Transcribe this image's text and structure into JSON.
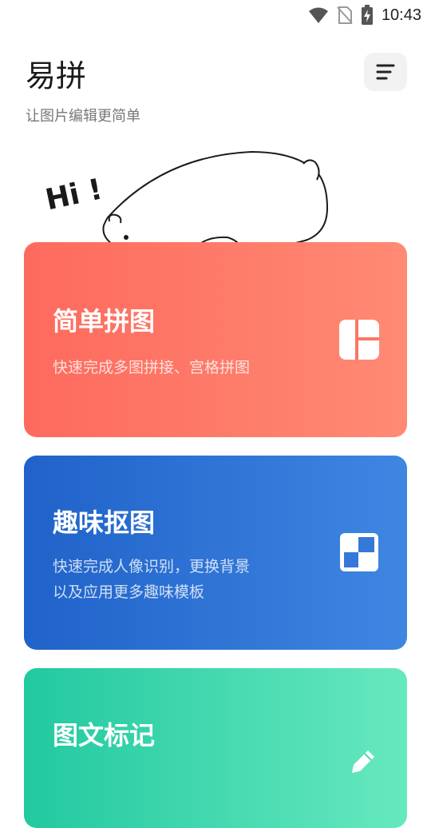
{
  "status": {
    "time": "10:43"
  },
  "header": {
    "title": "易拼",
    "subtitle": "让图片编辑更简单",
    "menu_icon": "menu-lines-icon"
  },
  "illustration": {
    "greeting": "Hi !"
  },
  "cards": [
    {
      "title": "简单拼图",
      "description": [
        "快速完成多图拼接、宫格拼图"
      ],
      "icon": "collage-grid-icon",
      "color": "#fd6a5d"
    },
    {
      "title": "趣味抠图",
      "description": [
        "快速完成人像识别，更换背景",
        "以及应用更多趣味模板"
      ],
      "icon": "cutout-icon",
      "color": "#2a6fd1"
    },
    {
      "title": "图文标记",
      "description": [],
      "icon": "pencil-icon",
      "color": "#2ecfa5"
    }
  ]
}
